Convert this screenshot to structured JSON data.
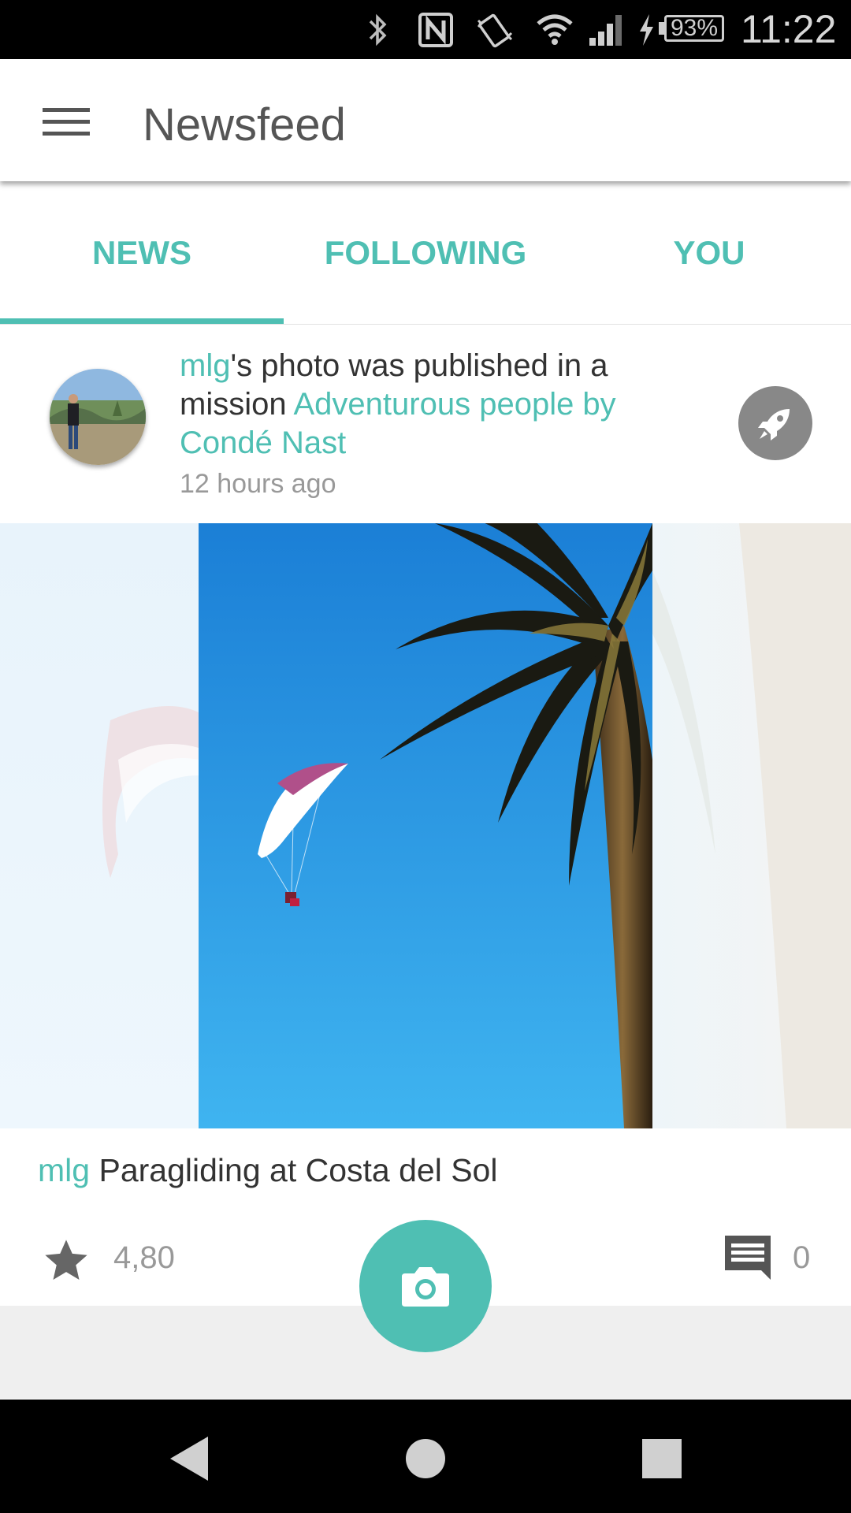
{
  "status_bar": {
    "battery": "93%",
    "time": "11:22",
    "icons": [
      "bluetooth-icon",
      "nfc-icon",
      "vibrate-icon",
      "wifi-icon",
      "cellular-signal-icon",
      "charging-icon",
      "battery-icon"
    ]
  },
  "app_bar": {
    "title": "Newsfeed",
    "menu_icon": "hamburger-menu-icon"
  },
  "tabs": [
    {
      "label": "NEWS",
      "selected": true
    },
    {
      "label": "FOLLOWING",
      "selected": false
    },
    {
      "label": "YOU",
      "selected": false
    }
  ],
  "feed_item": {
    "user": "mlg",
    "notification_text_1": "'s photo was published in a mission ",
    "mission_name": "Adventurous people by Condé Nast",
    "timestamp": "12 hours ago",
    "action_icon": "rocket-icon",
    "caption_user": "mlg",
    "caption_text": "Paragliding at Costa del Sol",
    "rating": "4,80",
    "comment_count": "0"
  },
  "fab": {
    "icon": "camera-icon"
  },
  "nav_bar": {
    "icons": [
      "back-icon",
      "home-icon",
      "recents-icon"
    ]
  },
  "colors": {
    "accent": "#4fbfb3",
    "status_bar": "#000000",
    "secondary_text": "#999999"
  }
}
